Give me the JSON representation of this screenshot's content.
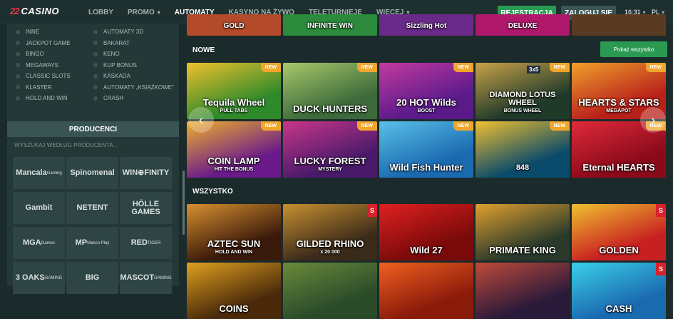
{
  "header": {
    "logo_mark": "22",
    "logo_text": "CASINO",
    "nav": [
      {
        "label": "LOBBY",
        "dropdown": false,
        "active": false
      },
      {
        "label": "PROMO",
        "dropdown": true,
        "active": false
      },
      {
        "label": "AUTOMATY",
        "dropdown": false,
        "active": true
      },
      {
        "label": "KASYNO NA ŻYWO",
        "dropdown": false,
        "active": false
      },
      {
        "label": "TELETURNIEJE",
        "dropdown": false,
        "active": false
      },
      {
        "label": "WIĘCEJ",
        "dropdown": true,
        "active": false
      }
    ],
    "register_label": "REJESTRACJA",
    "login_label": "ZALOGUJ SIĘ",
    "time": "16:31",
    "language": "PL"
  },
  "sidebar": {
    "categories": [
      "INNE",
      "AUTOMATY 3D",
      "JACKPOT GAME",
      "BAKARAT",
      "BINGO",
      "KENO",
      "MEGAWAYS",
      "KUP BONUS",
      "CLASSIC SLOTS",
      "KASKADA",
      "KLASTER",
      "AUTOMATY „KSIĄŻKOWE”",
      "HOLD AND WIN",
      "CRASH"
    ],
    "producers_title": "PRODUCENCI",
    "producers_search_placeholder": "WYSZUKAJ WEDŁUG PRODUCENTA...",
    "producers": [
      {
        "name": "Mancala",
        "sub": "Gaming"
      },
      {
        "name": "Spinomenal",
        "sub": ""
      },
      {
        "name": "WIN⊕FINITY",
        "sub": ""
      },
      {
        "name": "Gambit",
        "sub": ""
      },
      {
        "name": "NETENT",
        "sub": ""
      },
      {
        "name": "HÖLLE GAMES",
        "sub": ""
      },
      {
        "name": "MGA",
        "sub": "Games"
      },
      {
        "name": "MP",
        "sub": "Manco Play"
      },
      {
        "name": "RED",
        "sub": "TIGER"
      },
      {
        "name": "3 OAKS",
        "sub": "GAMING"
      },
      {
        "name": "BIG",
        "sub": ""
      },
      {
        "name": "MASCOT",
        "sub": "GAMING"
      }
    ]
  },
  "main": {
    "top_row": [
      {
        "title": "GOLD",
        "color": "#b34a2a"
      },
      {
        "title": "INFINITE WIN",
        "color": "#2b8a3c"
      },
      {
        "title": "Sizzling Hot",
        "color": "#6a2a8a"
      },
      {
        "title": "DELUXE",
        "color": "#b0186c"
      },
      {
        "title": "",
        "color": "#5a3a20"
      }
    ],
    "new_section": {
      "label": "NOWE",
      "show_all": "Pokaż wszystko",
      "badge": "NEW",
      "games": [
        {
          "title": "Tequila Wheel",
          "sub": "PULL TABS",
          "color1": "#2e8a2a",
          "color2": "#f0c02c"
        },
        {
          "title": "DUCK HUNTERS",
          "sub": "",
          "color1": "#3c6a3a",
          "color2": "#a8c86a"
        },
        {
          "title": "20 HOT Wilds",
          "sub": "BOOST",
          "color1": "#5a1a8a",
          "color2": "#c23aa0"
        },
        {
          "title": "DIAMOND LOTUS WHEEL",
          "sub": "BONUS WHEEL",
          "color1": "#203a2a",
          "color2": "#c8a24a"
        },
        {
          "title": "HEARTS & STARS",
          "sub": "MEGAPOT",
          "color1": "#b8201a",
          "color2": "#f0a02c"
        },
        {
          "title": "COIN LAMP",
          "sub": "HIT THE BONUS",
          "color1": "#6a1a8a",
          "color2": "#f0b02c"
        },
        {
          "title": "LUCKY FOREST",
          "sub": "MYSTERY",
          "color1": "#4a1a6a",
          "color2": "#c8368a"
        },
        {
          "title": "Wild Fish Hunter",
          "sub": "",
          "color1": "#1a6ab0",
          "color2": "#5ac0e8"
        },
        {
          "title": "848",
          "sub": "",
          "color1": "#0a4a6a",
          "color2": "#f0c030"
        },
        {
          "title": "Eternal HEARTS",
          "sub": "",
          "color1": "#8a0a1a",
          "color2": "#e02a3a"
        }
      ],
      "badge_3x5": "3x5"
    },
    "all_section": {
      "label": "WSZYSTKO",
      "games": [
        {
          "title": "AZTEC SUN",
          "sub": "HOLD AND WIN",
          "color1": "#3a1a0a",
          "color2": "#d89030"
        },
        {
          "title": "GILDED RHINO",
          "sub": "x 20 000",
          "color1": "#3a2a1a",
          "color2": "#c89030"
        },
        {
          "title": "Wild 27",
          "sub": "",
          "color1": "#7a0a0a",
          "color2": "#e02020"
        },
        {
          "title": "PRIMATE KING",
          "sub": "",
          "color1": "#2a3a2a",
          "color2": "#e0a030"
        },
        {
          "title": "GOLDEN",
          "sub": "",
          "color1": "#c82020",
          "color2": "#f0c030"
        },
        {
          "title": "COINS",
          "sub": "",
          "color1": "#4a2a0a",
          "color2": "#e0a020"
        },
        {
          "title": "",
          "sub": "",
          "color1": "#2a4a2a",
          "color2": "#6a8a3a"
        },
        {
          "title": "",
          "sub": "",
          "color1": "#8a1a0a",
          "color2": "#f06020"
        },
        {
          "title": "",
          "sub": "",
          "color1": "#2a1a3a",
          "color2": "#c04a3a"
        },
        {
          "title": "CASH",
          "sub": "",
          "color1": "#1a6ab0",
          "color2": "#3ad0e8"
        }
      ]
    }
  }
}
